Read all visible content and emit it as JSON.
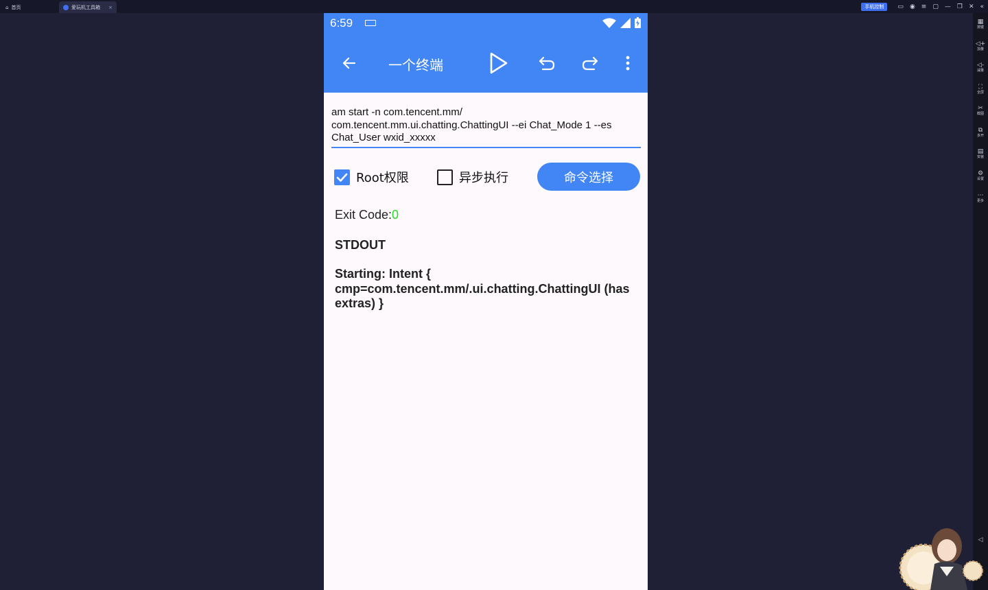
{
  "emulator": {
    "home_tab": "首页",
    "app_tab": "爱玩机工具箱",
    "tab_close": "×",
    "phone_control": "手机控制"
  },
  "sidebar": {
    "items": [
      {
        "label": "按键",
        "icon": "keyboard-icon"
      },
      {
        "label": "加量",
        "icon": "volume-up-icon"
      },
      {
        "label": "减量",
        "icon": "volume-down-icon"
      },
      {
        "label": "全屏",
        "icon": "fullscreen-icon"
      },
      {
        "label": "截图",
        "icon": "scissors-icon"
      },
      {
        "label": "多开",
        "icon": "multi-open-icon"
      },
      {
        "label": "安装",
        "icon": "install-icon"
      },
      {
        "label": "设置",
        "icon": "settings-icon"
      },
      {
        "label": "更多",
        "icon": "more-icon"
      }
    ]
  },
  "status": {
    "time": "6:59"
  },
  "appbar": {
    "title": "一个终端"
  },
  "command": {
    "value": "am start -n com.tencent.mm/ com.tencent.mm.ui.chatting.ChattingUI --ei Chat_Mode 1 --es Chat_User wxid_xxxxx"
  },
  "options": {
    "root_label": "Root权限",
    "root_checked": true,
    "async_label": "异步执行",
    "async_checked": false,
    "select_button": "命令选择"
  },
  "result": {
    "exit_label": "Exit Code:",
    "exit_code": "0",
    "stdout_header": "STDOUT",
    "stdout_text": "Starting: Intent { cmp=com.tencent.mm/.ui.chatting.ChattingUI (has extras) }"
  },
  "colors": {
    "accent": "#4285f4",
    "exit_ok": "#22dd22",
    "emulator_bg": "#1f2036"
  }
}
